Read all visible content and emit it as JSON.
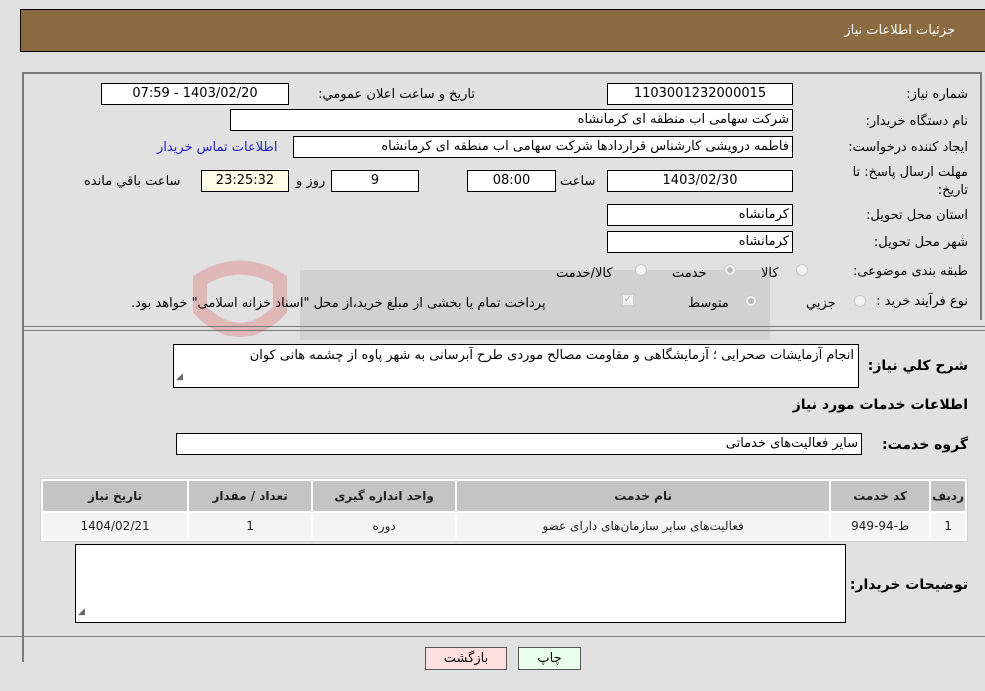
{
  "header": {
    "title": "جزئیات اطلاعات نیاز"
  },
  "form": {
    "need_number": {
      "label": "شماره نیاز:",
      "value": "1103001232000015"
    },
    "announce_datetime": {
      "label": "تاریخ و ساعت اعلان عمومي:",
      "value": "1403/02/20 - 07:59"
    },
    "buyer_org": {
      "label": "نام دستگاه خریدار:",
      "value": "شرکت سهامی اب منطقه ای کرمانشاه"
    },
    "requester": {
      "label": "ایجاد کننده درخواست:",
      "value": "فاطمه درویشی کارشناس قراردادها شرکت سهامی اب منطقه ای کرمانشاه"
    },
    "buyer_contact_link": "اطلاعات تماس خریدار",
    "deadline": {
      "label": "مهلت ارسال پاسخ: تا تاریخ:",
      "date": "1403/02/30",
      "time_label": "ساعت",
      "time": "08:00",
      "days": "9",
      "days_label": "روز و",
      "remaining": "23:25:32",
      "remaining_label": "ساعت باقي مانده"
    },
    "province": {
      "label": "استان محل تحویل:",
      "value": "کرمانشاه"
    },
    "city": {
      "label": "شهر محل تحویل:",
      "value": "کرمانشاه"
    },
    "category": {
      "label": "طبقه بندی موضوعی:",
      "options": [
        "کالا",
        "خدمت",
        "کالا/خدمت"
      ],
      "selected": "خدمت"
    },
    "purchase_type": {
      "label": "نوع فرآیند خرید :",
      "options": [
        "جزيي",
        "متوسط"
      ],
      "selected": "متوسط",
      "payment_note": "پرداخت تمام یا بخشی از مبلغ خرید،از محل \"اسناد خزانه اسلامی\" خواهد بود.",
      "payment_checked": true
    }
  },
  "description": {
    "label": "شرح کلي نیاز:",
    "value": "انجام آزمایشات صحرایی ؛ آزمایشگاهی و مقاومت مصالح موردی طرح آبرسانی به شهر پاوه از چشمه هانی کوان"
  },
  "services": {
    "section_title": "اطلاعات خدمات مورد نیاز",
    "group_label": "گروه خدمت:",
    "group_value": "سایر فعالیت‌های خدماتی",
    "table": {
      "headers": [
        "ردیف",
        "کد خدمت",
        "نام خدمت",
        "واحد اندازه گیری",
        "تعداد / مقدار",
        "تاریخ نیاز"
      ],
      "rows": [
        [
          "1",
          "ط-94-949",
          "فعالیت‌های سایر سازمان‌های دارای عضو",
          "دوره",
          "1",
          "1404/02/21"
        ]
      ]
    }
  },
  "buyer_notes": {
    "label": "توضیحات خریدار:",
    "value": ""
  },
  "buttons": {
    "print": "چاپ",
    "back": "بازگشت"
  },
  "colors": {
    "header_bg": "#8b6b42",
    "print_bg": "#eaffea",
    "back_bg": "#ffdede",
    "link": "#2222cc"
  }
}
